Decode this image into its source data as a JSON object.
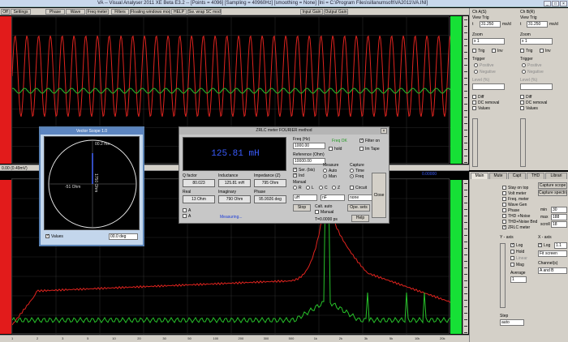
{
  "window": {
    "title": "VA -- Visual Analyser 2011 XE Beta E3.2 -- [Points = 4096] [Sampling = 40960Hz] [smoothing = None] [Ini = C:\\Program Files\\sillanumsoft\\VA2011\\VA.INI]"
  },
  "toolbar": {
    "items": [
      "Off",
      "Settings",
      "Phase",
      "Wave",
      "Freq meter",
      "Filters",
      "Floating windows mode",
      "HELP",
      "Sw. wrap SC mode",
      "Input Gain",
      "Output Gain"
    ]
  },
  "scope": {
    "status_text": "0.00 (0.49mV)",
    "colors": {
      "channel_a": "#e0231e",
      "channel_b": "#27c22a",
      "grid": "#2a2a2a",
      "left_bar": "#e21b1b",
      "right_bar": "#16e036"
    }
  },
  "right_top": {
    "ch_a": {
      "title": "Ch A(S)",
      "view_trig": "View Trig",
      "time_label": "t",
      "time_value": "31.250",
      "time_unit": "ms/d",
      "zoom_label": "Zoom",
      "zoom_value": "x 1",
      "trigger_label": "Trigger",
      "trigger_options": [
        "Positive",
        "Negative"
      ],
      "trigger_level_label": "Level (%)",
      "options": [
        "Diff",
        "DC removal",
        "Values"
      ]
    },
    "ch_b": {
      "title": "Ch B(R)",
      "view_trig": "View Trig",
      "time_label": "t",
      "time_value": "31.250",
      "time_unit": "ms/d",
      "zoom_label": "Zoom",
      "zoom_value": "x 1",
      "trigger_label": "Trigger",
      "trigger_options": [
        "Positive",
        "Negative"
      ],
      "trigger_level_label": "Level (%)",
      "options": [
        "Diff",
        "DC removal",
        "Values"
      ]
    },
    "bottom_checks": [
      "Trig",
      "Inv"
    ]
  },
  "spectrum": {
    "top_left_label": "",
    "top_right_label": "0.00000",
    "colors": {
      "channel_a": "#e0231e",
      "channel_b": "#27c22a",
      "grid": "#2a2a2a"
    }
  },
  "right_bot": {
    "tabs": [
      "Main",
      "Mute",
      "Capt",
      "THD",
      "Librari"
    ],
    "checks": [
      "Stay on top",
      "Volt meter",
      "Freq. meter",
      "Wave Gen",
      "Phase",
      "THD +Noise",
      "THD+Noise Bnd",
      "ZRLC meter"
    ],
    "capture_label": "Capture scope",
    "capture_spectrum": "Capture spectrum",
    "fields": [
      {
        "label": "min",
        "value": "30"
      },
      {
        "label": "max",
        "value": "188"
      },
      {
        "label": "scroll",
        "value": "18"
      }
    ],
    "y_axis": "Y - axis",
    "y_options": [
      "Log",
      "Hold",
      "Linear",
      "Mag"
    ],
    "average_label": "Average",
    "average_value": "1",
    "x_axis": "X - axis",
    "x_options": [
      "Log",
      "Fit screen"
    ],
    "channels_label": "Channel(s)",
    "channels_value": "A and B",
    "scale_value": "1.1",
    "step_label": "Step",
    "step_value": "auto"
  },
  "vector_scope": {
    "title": "Vector Scope 1.0",
    "top_label": "00.2 ms",
    "mag_label": "1750 Ohm",
    "neg_label": "-51 Ohm",
    "values_label": "Values",
    "angle_value": "00.0 deg"
  },
  "zrlc": {
    "title": "ZRLC meter FOURIER method",
    "display": "125.81 mH",
    "freq_label": "Freq (Hz)",
    "freq_value": "1000.00",
    "freq_ok": "Freq OK",
    "hold_label": "hold",
    "filter_on": "Filter on",
    "im_rate": "Im Tape",
    "reference_label": "Reference (Ohm)",
    "reference_value": "10000.00",
    "checks": [
      "Ser. (bis)",
      "Ind",
      "Auto"
    ],
    "measure_label": "Measure",
    "measure_options": [
      "Auto",
      "Man"
    ],
    "capture_label": "Capture",
    "capture_options": [
      "Time",
      "Freq"
    ],
    "manual_label": "Manual",
    "manual_options": [
      "R",
      "L",
      "C",
      "Z"
    ],
    "circuit_label": "Circuit",
    "q_factor_label": "Q factor",
    "q_factor_value": "80.023",
    "inductance_label": "Inductance",
    "inductance_value": "125.81 mH",
    "impedance_label": "Impedance (Z)",
    "impedance_value": "795 Ohm",
    "real_label": "Real",
    "real_value": "13 Ohm",
    "imaginary_label": "Imaginary",
    "imaginary_value": "790 Ohm",
    "phase_label": "Phase",
    "phase_value": "95.9926 deg",
    "unit_a": "uH",
    "unit_b": "nF",
    "unit_c": "none",
    "measuring": "Measuring...",
    "stop_button": "Stop",
    "cal_label": "Calt. auto",
    "manual_check": "Manual",
    "time_value": "T=0.0000 ps",
    "ab_label": "A",
    "b_label": "A",
    "help_button": "Help",
    "close_button": "Close",
    "open_button": "Ope. sets"
  },
  "bottom_axis": {
    "labels": [
      "1",
      "2",
      "3",
      "5",
      "10",
      "20",
      "30",
      "50",
      "100",
      "200",
      "300",
      "500",
      "1k",
      "2k",
      "3k",
      "5k",
      "10k",
      "20k"
    ]
  }
}
